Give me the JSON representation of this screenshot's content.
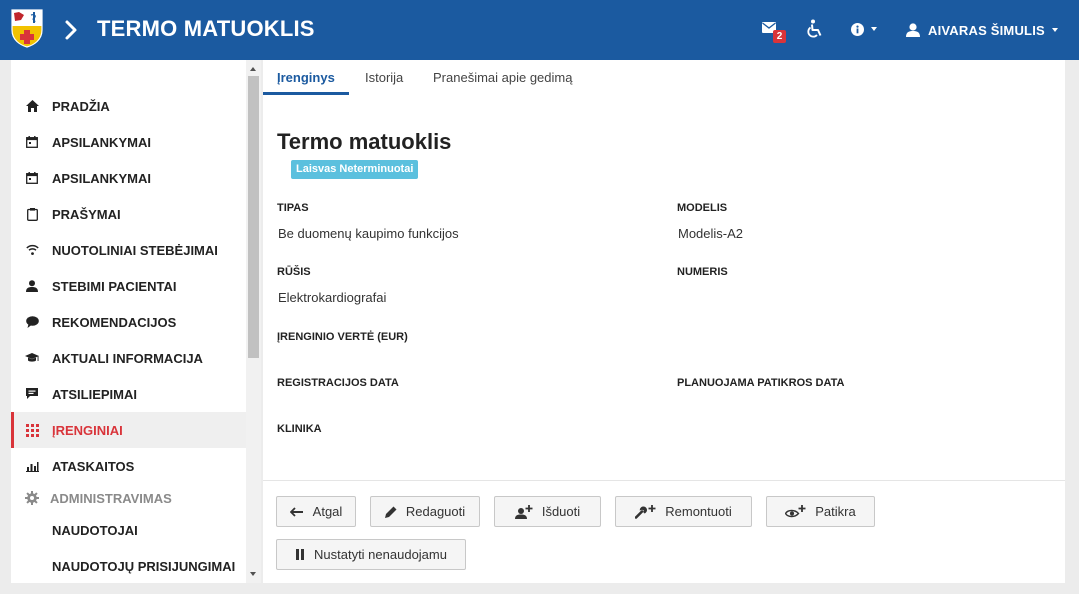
{
  "header": {
    "app_title": "TERMO MATUOKLIS",
    "mail_count": "2",
    "user_name": "AIVARAS ŠIMULIS"
  },
  "sidebar": {
    "items": [
      {
        "label": "PRADŽIA",
        "icon": "home-icon"
      },
      {
        "label": "APSILANKYMAI",
        "icon": "calendar-icon"
      },
      {
        "label": "APSILANKYMAI",
        "icon": "calendar-icon"
      },
      {
        "label": "PRAŠYMAI",
        "icon": "clipboard-icon"
      },
      {
        "label": "NUOTOLINIAI STEBĖJIMAI",
        "icon": "wifi-icon"
      },
      {
        "label": "STEBIMI PACIENTAI",
        "icon": "person-icon"
      },
      {
        "label": "REKOMENDACIJOS",
        "icon": "speech-bubble-icon"
      },
      {
        "label": "AKTUALI INFORMACIJA",
        "icon": "graduation-cap-icon"
      },
      {
        "label": "ATSILIEPIMAI",
        "icon": "feedback-icon"
      },
      {
        "label": "ĮRENGINIAI",
        "icon": "grid-icon",
        "active": true
      },
      {
        "label": "ATASKAITOS",
        "icon": "bar-chart-icon"
      }
    ],
    "section": {
      "label": "ADMINISTRAVIMAS",
      "icon": "gear-icon"
    },
    "sub_items": [
      {
        "label": "NAUDOTOJAI"
      },
      {
        "label": "NAUDOTOJŲ PRISIJUNGIMAI"
      }
    ]
  },
  "tabs": [
    {
      "label": "Įrenginys",
      "active": true
    },
    {
      "label": "Istorija"
    },
    {
      "label": "Pranešimai apie gedimą"
    }
  ],
  "device": {
    "title": "Termo matuoklis",
    "status": "Laisvas Neterminuotai",
    "fields": {
      "tipas": {
        "label": "TIPAS",
        "value": "Be duomenų kaupimo funkcijos"
      },
      "modelis": {
        "label": "MODELIS",
        "value": "Modelis-A2"
      },
      "rusis": {
        "label": "RŪŠIS",
        "value": "Elektrokardiografai"
      },
      "numeris": {
        "label": "NUMERIS",
        "value": ""
      },
      "verte": {
        "label": "ĮRENGINIO VERTĖ (EUR)",
        "value": ""
      },
      "reg_data": {
        "label": "REGISTRACIJOS DATA",
        "value": ""
      },
      "patikros_data": {
        "label": "PLANUOJAMA PATIKROS DATA",
        "value": ""
      },
      "klinika": {
        "label": "KLINIKA",
        "value": ""
      }
    }
  },
  "actions": {
    "back": "Atgal",
    "edit": "Redaguoti",
    "issue": "Išduoti",
    "repair": "Remontuoti",
    "inspect": "Patikra",
    "set_unused": "Nustatyti nenaudojamu"
  },
  "colors": {
    "header_bg": "#1b5aa0",
    "accent_red": "#d9343a",
    "status_badge": "#5bc0de"
  }
}
